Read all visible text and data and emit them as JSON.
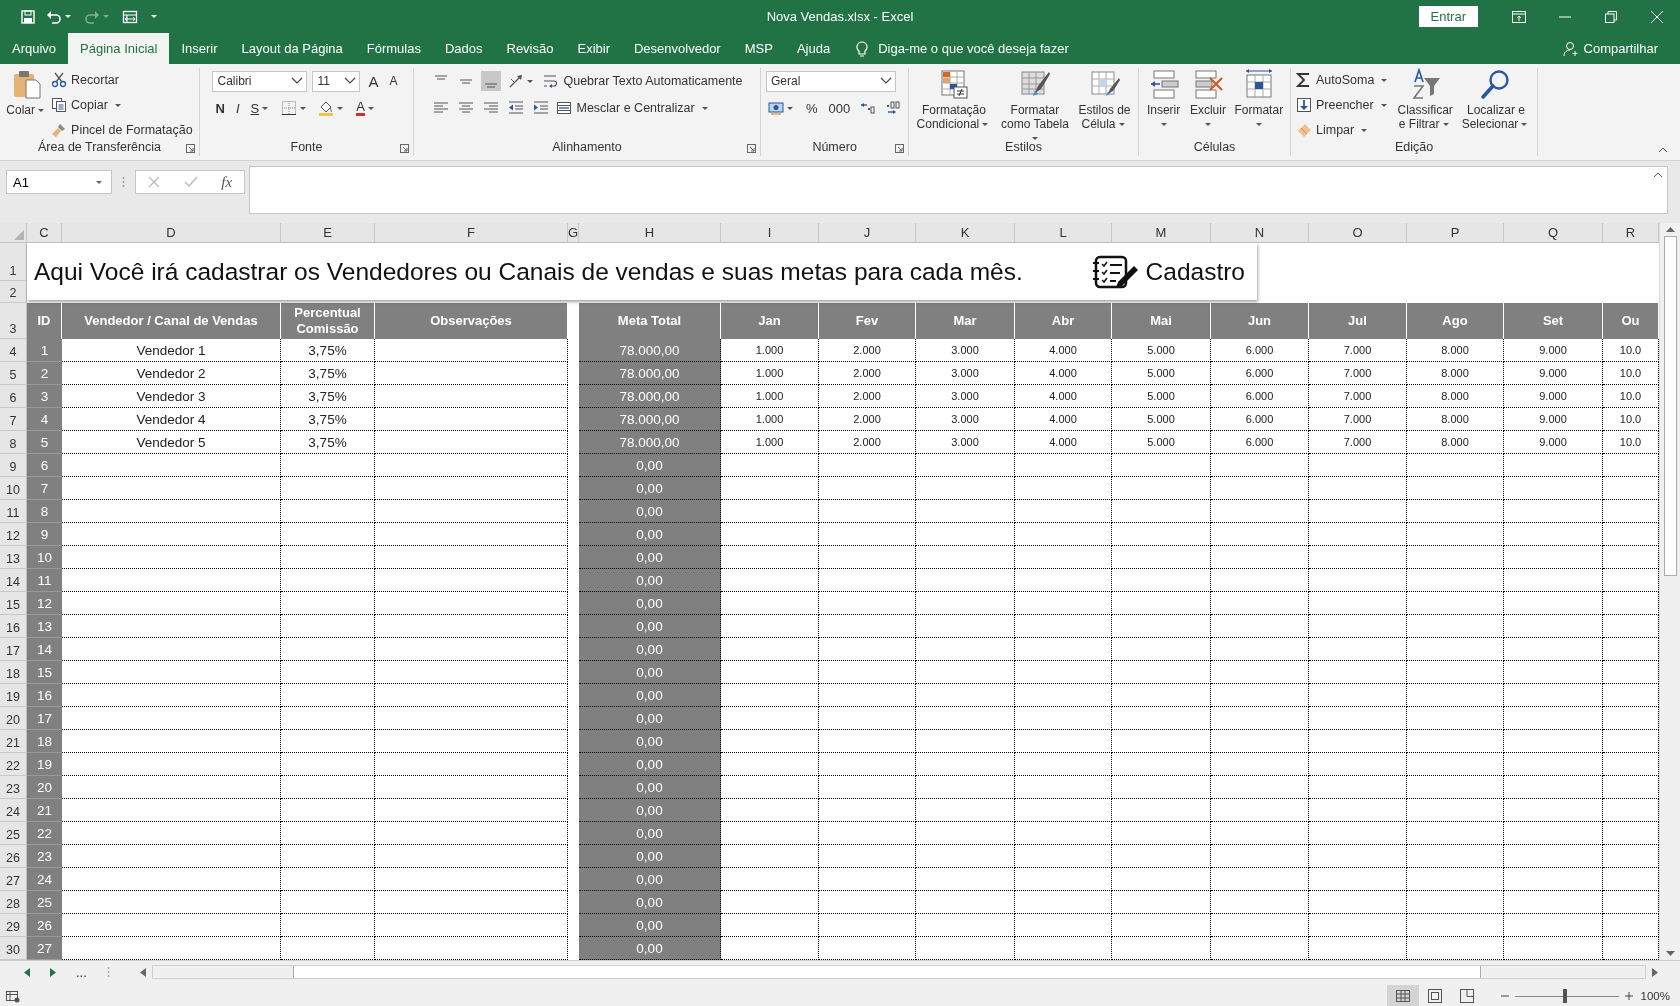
{
  "title_bar": {
    "title": "Nova Vendas.xlsx  -  Excel",
    "sign_in": "Entrar"
  },
  "quick_access": [
    {
      "disabled": false
    },
    {
      "disabled": false
    },
    {
      "disabled": true
    },
    {
      "disabled": false
    }
  ],
  "tabs": [
    {
      "label": "Arquivo",
      "selected": false
    },
    {
      "label": "Página Inicial",
      "selected": true
    },
    {
      "label": "Inserir",
      "selected": false
    },
    {
      "label": "Layout da Página",
      "selected": false
    },
    {
      "label": "Fórmulas",
      "selected": false
    },
    {
      "label": "Dados",
      "selected": false
    },
    {
      "label": "Revisão",
      "selected": false
    },
    {
      "label": "Exibir",
      "selected": false
    },
    {
      "label": "Desenvolvedor",
      "selected": false
    },
    {
      "label": "MSP",
      "selected": false
    },
    {
      "label": "Ajuda",
      "selected": false
    }
  ],
  "tell_me": "Diga-me o que você deseja fazer",
  "share": "Compartilhar",
  "ribbon": {
    "groups": [
      {
        "label": "Área de Transferência",
        "launcher": true,
        "items": [
          {
            "kind": "large",
            "label": "Colar",
            "menu": true
          },
          {
            "kind": "stack",
            "items": [
              {
                "kind": "small",
                "label": "Recortar",
                "menu": false
              },
              {
                "kind": "small",
                "label": "Copiar",
                "menu": true
              },
              {
                "kind": "small",
                "label": "Pincel de Formatação",
                "menu": false
              }
            ]
          }
        ]
      },
      {
        "label": "Fonte",
        "launcher": true,
        "items": [
          {
            "kind": "stack",
            "items": [
              {
                "kind": "row",
                "items": [
                  {
                    "kind": "field",
                    "value": "Calibri"
                  },
                  {
                    "kind": "field",
                    "value": "11"
                  },
                  {
                    "kind": "grow",
                    "label": "A",
                    "menu": false
                  },
                  {
                    "kind": "shrink",
                    "label": "A",
                    "menu": false
                  }
                ]
              },
              {
                "kind": "row",
                "items": [
                  {
                    "kind": "bold",
                    "label": "N",
                    "menu": false
                  },
                  {
                    "kind": "italic",
                    "label": "I",
                    "menu": false
                  },
                  {
                    "kind": "underline",
                    "label": "S",
                    "menu": true
                  },
                  {
                    "kind": "icon",
                    "menu": true
                  },
                  {
                    "kind": "icon",
                    "menu": true
                  },
                  {
                    "kind": "color",
                    "label": "A",
                    "menu": true
                  }
                ]
              }
            ]
          }
        ]
      },
      {
        "label": "Alinhamento",
        "launcher": true,
        "items": [
          {
            "kind": "stack",
            "items": [
              {
                "kind": "row",
                "items": [
                  {
                    "kind": "icon",
                    "selected": false,
                    "menu": false
                  },
                  {
                    "kind": "icon",
                    "selected": false,
                    "menu": false
                  },
                  {
                    "kind": "icon",
                    "selected": true,
                    "menu": false
                  },
                  {
                    "kind": "icon",
                    "menu": true
                  },
                  {
                    "kind": "small",
                    "label": "Quebrar Texto Automaticamente",
                    "menu": false
                  }
                ]
              },
              {
                "kind": "row",
                "items": [
                  {
                    "kind": "icon",
                    "selected": false,
                    "menu": false
                  },
                  {
                    "kind": "icon",
                    "selected": false,
                    "menu": false
                  },
                  {
                    "kind": "icon",
                    "selected": false,
                    "menu": false
                  },
                  {
                    "kind": "icon",
                    "menu": false
                  },
                  {
                    "kind": "icon",
                    "menu": false
                  },
                  {
                    "kind": "small",
                    "label": "Mesclar e Centralizar",
                    "menu": true
                  }
                ]
              }
            ]
          }
        ]
      },
      {
        "label": "Número",
        "launcher": true,
        "items": [
          {
            "kind": "stack",
            "items": [
              {
                "kind": "row",
                "items": [
                  {
                    "kind": "field",
                    "value": "Geral"
                  }
                ]
              },
              {
                "kind": "row",
                "items": [
                  {
                    "kind": "icon",
                    "menu": true
                  },
                  {
                    "kind": "text",
                    "label": "%"
                  },
                  {
                    "kind": "text",
                    "label": "000"
                  },
                  {
                    "kind": "icon",
                    "menu": false
                  },
                  {
                    "kind": "icon",
                    "menu": false
                  }
                ]
              }
            ]
          }
        ]
      },
      {
        "label": "Estilos",
        "launcher": false,
        "items": [
          {
            "kind": "large",
            "label": "Formatação Condicional",
            "menu": true
          },
          {
            "kind": "large",
            "label": "Formatar como Tabela",
            "menu": true
          },
          {
            "kind": "large",
            "label": "Estilos de Célula",
            "menu": true
          }
        ]
      },
      {
        "label": "Células",
        "launcher": false,
        "items": [
          {
            "kind": "large",
            "label": "Inserir",
            "menu": true
          },
          {
            "kind": "large",
            "label": "Excluir",
            "menu": true
          },
          {
            "kind": "large",
            "label": "Formatar",
            "menu": true
          }
        ]
      },
      {
        "label": "Edição",
        "launcher": false,
        "items": [
          {
            "kind": "stack",
            "items": [
              {
                "kind": "small",
                "label": "AutoSoma",
                "menu": true
              },
              {
                "kind": "small",
                "label": "Preencher",
                "menu": true
              },
              {
                "kind": "small",
                "label": "Limpar",
                "menu": true
              }
            ]
          },
          {
            "kind": "large",
            "label": "Classificar e Filtrar",
            "menu": true
          },
          {
            "kind": "large",
            "label": "Localizar e Selecionar",
            "menu": true
          }
        ]
      }
    ]
  },
  "formula_bar": {
    "name_box": "A1",
    "function_label": "fx"
  },
  "sheet": {
    "columns": [
      "C",
      "D",
      "E",
      "F",
      "G",
      "H",
      "I",
      "J",
      "K",
      "L",
      "M",
      "N",
      "O",
      "P",
      "Q",
      "R"
    ],
    "banner": {
      "rows": [
        "1",
        "2"
      ],
      "text": "Aqui Você irá cadastrar os Vendedores ou Canais de vendas e suas metas para cada mês.",
      "label": "Cadastro"
    },
    "header_row": "3",
    "header": [
      "ID",
      "Vendedor / Canal de Vendas",
      "Percentual Comissão",
      "Observações",
      "Meta Total",
      "Jan",
      "Fev",
      "Mar",
      "Abr",
      "Mai",
      "Jun",
      "Jul",
      "Ago",
      "Set",
      "Ou"
    ],
    "rows": [
      {
        "row": "4",
        "id": "1",
        "vendor": "Vendedor 1",
        "commission": "3,75%",
        "meta": "78.000,00",
        "months": [
          "1.000",
          "2.000",
          "3.000",
          "4.000",
          "5.000",
          "6.000",
          "7.000",
          "8.000",
          "9.000",
          "10.0"
        ]
      },
      {
        "row": "5",
        "id": "2",
        "vendor": "Vendedor 2",
        "commission": "3,75%",
        "meta": "78.000,00",
        "months": [
          "1.000",
          "2.000",
          "3.000",
          "4.000",
          "5.000",
          "6.000",
          "7.000",
          "8.000",
          "9.000",
          "10.0"
        ]
      },
      {
        "row": "6",
        "id": "3",
        "vendor": "Vendedor 3",
        "commission": "3,75%",
        "meta": "78.000,00",
        "months": [
          "1.000",
          "2.000",
          "3.000",
          "4.000",
          "5.000",
          "6.000",
          "7.000",
          "8.000",
          "9.000",
          "10.0"
        ]
      },
      {
        "row": "7",
        "id": "4",
        "vendor": "Vendedor 4",
        "commission": "3,75%",
        "meta": "78.000,00",
        "months": [
          "1.000",
          "2.000",
          "3.000",
          "4.000",
          "5.000",
          "6.000",
          "7.000",
          "8.000",
          "9.000",
          "10.0"
        ]
      },
      {
        "row": "8",
        "id": "5",
        "vendor": "Vendedor 5",
        "commission": "3,75%",
        "meta": "78.000,00",
        "months": [
          "1.000",
          "2.000",
          "3.000",
          "4.000",
          "5.000",
          "6.000",
          "7.000",
          "8.000",
          "9.000",
          "10.0"
        ]
      },
      {
        "row": "9",
        "id": "6",
        "meta": "0,00"
      },
      {
        "row": "10",
        "id": "7",
        "meta": "0,00"
      },
      {
        "row": "11",
        "id": "8",
        "meta": "0,00"
      },
      {
        "row": "12",
        "id": "9",
        "meta": "0,00"
      },
      {
        "row": "13",
        "id": "10",
        "meta": "0,00"
      },
      {
        "row": "14",
        "id": "11",
        "meta": "0,00"
      },
      {
        "row": "15",
        "id": "12",
        "meta": "0,00"
      },
      {
        "row": "16",
        "id": "13",
        "meta": "0,00"
      },
      {
        "row": "17",
        "id": "14",
        "meta": "0,00"
      },
      {
        "row": "18",
        "id": "15",
        "meta": "0,00"
      },
      {
        "row": "19",
        "id": "16",
        "meta": "0,00"
      },
      {
        "row": "20",
        "id": "17",
        "meta": "0,00"
      },
      {
        "row": "21",
        "id": "18",
        "meta": "0,00"
      },
      {
        "row": "22",
        "id": "19",
        "meta": "0,00"
      },
      {
        "row": "23",
        "id": "20",
        "meta": "0,00"
      },
      {
        "row": "24",
        "id": "21",
        "meta": "0,00"
      },
      {
        "row": "25",
        "id": "22",
        "meta": "0,00"
      },
      {
        "row": "26",
        "id": "23",
        "meta": "0,00"
      },
      {
        "row": "27",
        "id": "24",
        "meta": "0,00"
      },
      {
        "row": "28",
        "id": "25",
        "meta": "0,00"
      },
      {
        "row": "29",
        "id": "26",
        "meta": "0,00"
      },
      {
        "row": "30",
        "id": "27",
        "meta": "0,00"
      }
    ]
  },
  "sheet_nav": {
    "more": "..."
  },
  "status_bar": {
    "views": [
      {
        "selected": true
      },
      {
        "selected": false
      },
      {
        "selected": false
      }
    ],
    "zoom": {
      "level": 0.48,
      "label": "100%"
    }
  }
}
